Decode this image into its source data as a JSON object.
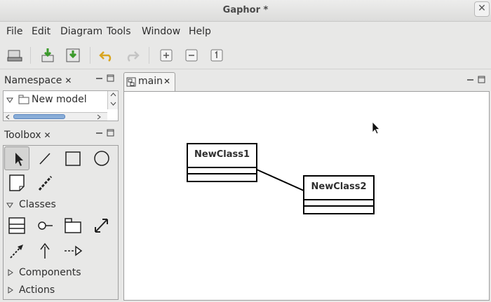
{
  "window": {
    "title": "Gaphor *"
  },
  "menu": [
    "File",
    "Edit",
    "Diagram",
    "Tools",
    "Window",
    "Help"
  ],
  "toolbar": {
    "buttons": [
      "open-icon",
      "save-icon",
      "save-as-icon",
      "undo-icon",
      "redo-icon",
      "zoom-in-icon",
      "zoom-out-icon",
      "zoom-reset-icon"
    ]
  },
  "namespace": {
    "title": "Namespace",
    "close": "✕",
    "items": [
      {
        "label": "New model"
      }
    ]
  },
  "toolbox": {
    "title": "Toolbox",
    "close": "✕",
    "sections": [
      {
        "label": "Classes",
        "expanded": true
      },
      {
        "label": "Components",
        "expanded": false
      },
      {
        "label": "Actions",
        "expanded": false
      }
    ]
  },
  "diagram": {
    "tab": "main",
    "close": "✕",
    "classes": [
      {
        "name": "NewClass1"
      },
      {
        "name": "NewClass2"
      }
    ]
  }
}
